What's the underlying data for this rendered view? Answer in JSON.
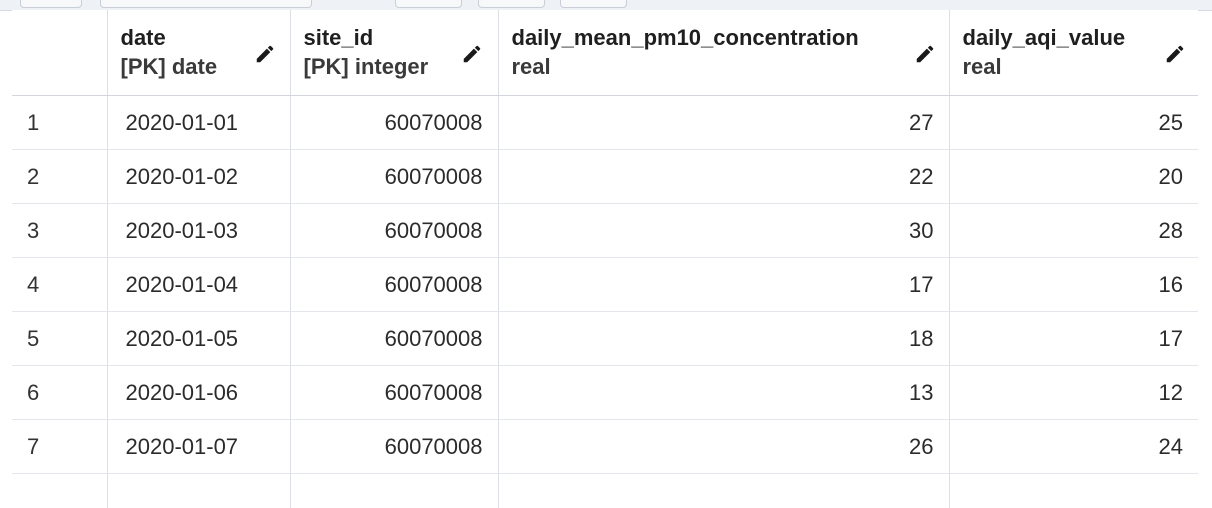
{
  "columns": [
    {
      "name": "date",
      "type": "[PK] date"
    },
    {
      "name": "site_id",
      "type": "[PK] integer"
    },
    {
      "name": "daily_mean_pm10_concentration",
      "type": "real"
    },
    {
      "name": "daily_aqi_value",
      "type": "real"
    }
  ],
  "edit_icon": "pencil-icon",
  "rows": [
    {
      "n": "1",
      "date": "2020-01-01",
      "site_id": "60070008",
      "pm10": "27",
      "aqi": "25"
    },
    {
      "n": "2",
      "date": "2020-01-02",
      "site_id": "60070008",
      "pm10": "22",
      "aqi": "20"
    },
    {
      "n": "3",
      "date": "2020-01-03",
      "site_id": "60070008",
      "pm10": "30",
      "aqi": "28"
    },
    {
      "n": "4",
      "date": "2020-01-04",
      "site_id": "60070008",
      "pm10": "17",
      "aqi": "16"
    },
    {
      "n": "5",
      "date": "2020-01-05",
      "site_id": "60070008",
      "pm10": "18",
      "aqi": "17"
    },
    {
      "n": "6",
      "date": "2020-01-06",
      "site_id": "60070008",
      "pm10": "13",
      "aqi": "12"
    },
    {
      "n": "7",
      "date": "2020-01-07",
      "site_id": "60070008",
      "pm10": "26",
      "aqi": "24"
    }
  ]
}
